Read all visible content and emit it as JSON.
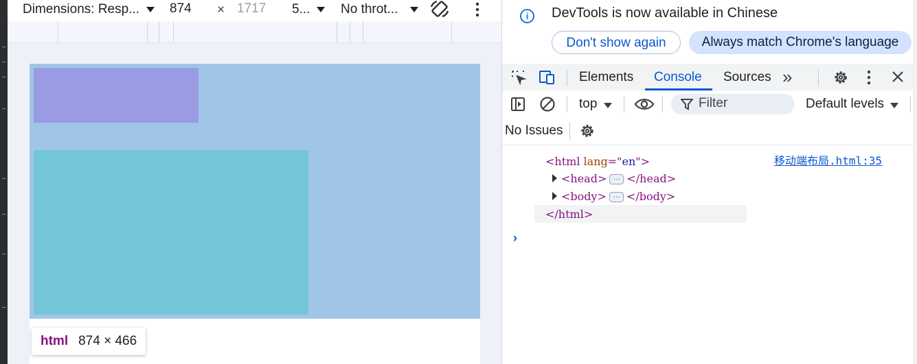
{
  "device_toolbar": {
    "dimensions_label": "Dimensions: Resp...",
    "width_value": "874",
    "times_sign": "×",
    "height_placeholder": "1717",
    "zoom_label": "5...",
    "throttle_label": "No throt..."
  },
  "viewport": {
    "highlight_color": "#a0c5e7",
    "box1_color": "#9b9be3",
    "box2_color": "#73c6d9",
    "tooltip": {
      "tag": "html",
      "size": "874 × 466"
    }
  },
  "devtools": {
    "info_bar": {
      "icon": "i",
      "message": "DevTools is now available in Chinese",
      "dont_show_label": "Don't show again",
      "always_match_label": "Always match Chrome's language"
    },
    "tabs": [
      {
        "label": "Elements"
      },
      {
        "label": "Console",
        "active": true
      },
      {
        "label": "Sources"
      }
    ],
    "more_tabs_icon": "»",
    "console_toolbar": {
      "context_label": "top",
      "filter_placeholder": "Filter",
      "levels_label": "Default levels"
    },
    "issues_label": "No Issues",
    "console": {
      "source_link": "移动端布局.html:35",
      "line1": {
        "open": "<html",
        "attr_name": "lang",
        "eq": "=\"",
        "attr_value": "en",
        "close": "\">"
      },
      "line2": {
        "open": "<head>",
        "ellipsis": "…",
        "close": "</head>"
      },
      "line3": {
        "open": "<body>",
        "ellipsis": "…",
        "close": "</body>"
      },
      "line4": {
        "close": "</html>"
      },
      "prompt": "›"
    }
  }
}
